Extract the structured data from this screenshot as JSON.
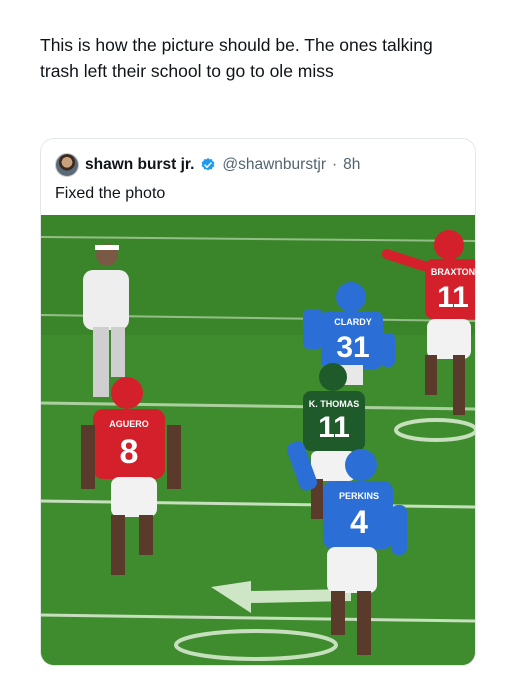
{
  "post": {
    "text": "This is how the picture should be. The ones talking trash left their school to go to ole miss"
  },
  "quote": {
    "author_name": "shawn burst jr.",
    "handle": "@shawnburstjr",
    "separator": "·",
    "time": "8h",
    "text": "Fixed the photo",
    "verified_color": "#1d9bf0",
    "avatar_icon": "user-avatar"
  },
  "photo": {
    "description_icon": "football-photo",
    "players": [
      {
        "name": "BRAXTON",
        "number": "11",
        "jersey_color": "#d4202a"
      },
      {
        "name": "CLARDY",
        "number": "31",
        "jersey_color": "#2b6fd6"
      },
      {
        "name": "K. THOMAS",
        "number": "11",
        "jersey_color": "#1f5a2a"
      },
      {
        "name": "AGUERO",
        "number": "8",
        "jersey_color": "#d4202a"
      },
      {
        "name": "PERKINS",
        "number": "4",
        "jersey_color": "#2b6fd6"
      }
    ],
    "field_color": "#3f8c2e"
  }
}
